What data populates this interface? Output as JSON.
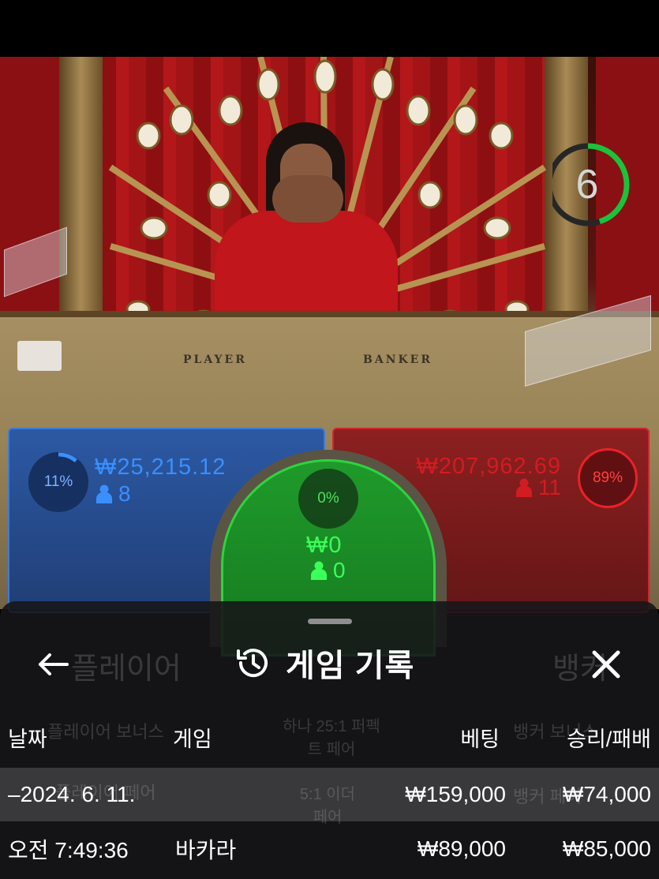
{
  "video": {
    "felt_player_label": "PLAYER",
    "felt_banker_label": "BANKER",
    "countdown": "6",
    "countdown_fraction": 0.45,
    "colors": {
      "timer_arc": "#1cc23a",
      "timer_track": "#2a2a2a"
    }
  },
  "bets": {
    "player": {
      "percent_label": "11%",
      "percent": 11,
      "amount": "₩25,215.12",
      "players": "8",
      "color": "#3a8fff"
    },
    "tie": {
      "percent_label": "0%",
      "percent": 0,
      "amount": "₩0",
      "players": "0",
      "color": "#3bff5a"
    },
    "banker": {
      "percent_label": "89%",
      "percent": 89,
      "amount": "₩207,962.69",
      "players": "11",
      "color": "#d31b22"
    },
    "person_icon": "person-icon"
  },
  "background_labels": {
    "player_zone": "플레이어",
    "banker_zone": "뱅커",
    "player_bonus": "플레이어 보너스",
    "perfect_pair": "하나 25:1 퍼펙트 페어",
    "banker_bonus": "뱅커 보너스",
    "player_pair": "플레이어 페어",
    "either_pair": "5:1 이더 페어",
    "banker_pair": "뱅커 페어"
  },
  "history": {
    "title": "게임 기록",
    "back_icon": "arrow-left-icon",
    "title_icon": "history-icon",
    "close_icon": "close-icon",
    "columns": {
      "date": "날짜",
      "game": "게임",
      "bet": "베팅",
      "result": "승리/패배"
    },
    "groups": [
      {
        "collapse_symbol": "–",
        "date": "2024. 6. 11.",
        "total_bet": "₩159,000",
        "total_result": "₩74,000",
        "rows": [
          {
            "time": "오전 7:49:36",
            "game": "바카라",
            "bet": "₩89,000",
            "result": "₩85,000"
          }
        ]
      }
    ]
  }
}
